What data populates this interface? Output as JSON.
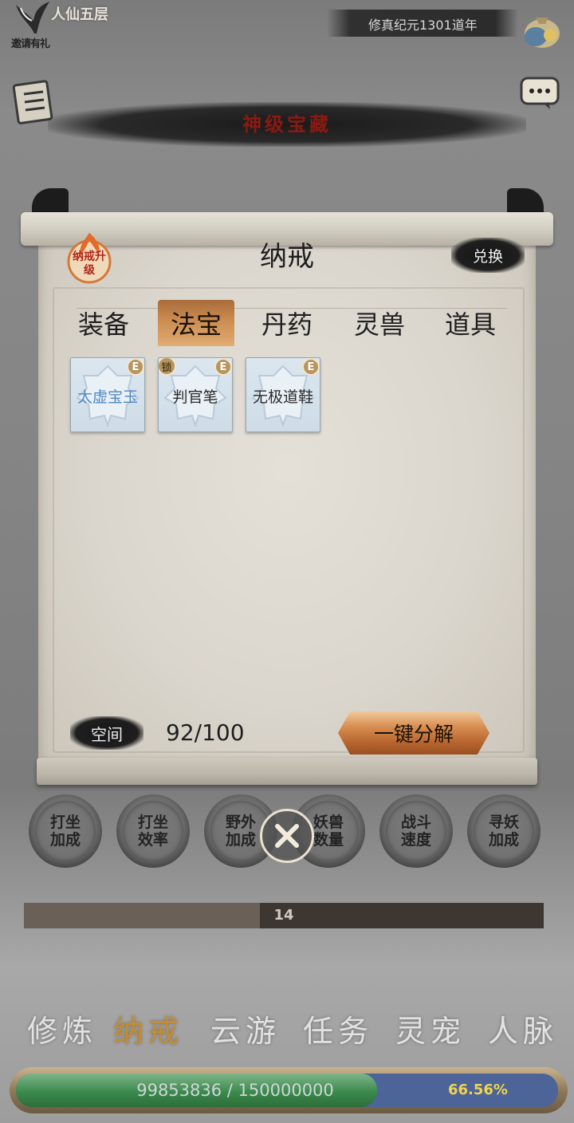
{
  "header": {
    "invite_text": "邀请有礼",
    "realm": "人仙五层",
    "era": "修真纪元1301道年",
    "title": "神级宝藏"
  },
  "panel": {
    "title": "纳戒",
    "upgrade_badge": "纳戒升级",
    "exchange_label": "兑换",
    "tabs": [
      {
        "label": "装备",
        "active": false
      },
      {
        "label": "法宝",
        "active": true
      },
      {
        "label": "丹药",
        "active": false
      },
      {
        "label": "灵兽",
        "active": false
      },
      {
        "label": "道具",
        "active": false
      }
    ],
    "items": [
      {
        "name": "太虚宝玉",
        "badge": "E",
        "locked": false,
        "name_color": "#4d88c4"
      },
      {
        "name": "判官笔",
        "badge": "E",
        "locked": true,
        "lock_label": "锁",
        "name_color": "#2a2a2a"
      },
      {
        "name": "无极道鞋",
        "badge": "E",
        "locked": false,
        "name_color": "#2a2a2a"
      }
    ],
    "space_label": "空间",
    "space_value": "92/100",
    "decompose_label": "一键分解"
  },
  "bonuses": [
    {
      "line1": "打坐",
      "line2": "加成"
    },
    {
      "line1": "打坐",
      "line2": "效率"
    },
    {
      "line1": "野外",
      "line2": "加成"
    },
    {
      "line1": "妖兽",
      "line2": "数量"
    },
    {
      "line1": "战斗",
      "line2": "速度"
    },
    {
      "line1": "寻妖",
      "line2": "加成"
    }
  ],
  "level": {
    "value": "14",
    "fill_fraction": 0.454
  },
  "nav": [
    {
      "label": "修炼",
      "active": false
    },
    {
      "label": "纳戒",
      "active": true
    },
    {
      "label": "云游",
      "active": false
    },
    {
      "label": "任务",
      "active": false
    },
    {
      "label": "灵宠",
      "active": false
    },
    {
      "label": "人脉",
      "active": false
    }
  ],
  "exp": {
    "text": "99853836 / 150000000",
    "percent": "66.56%",
    "fill_fraction": 0.6656
  },
  "colors": {
    "accent_gold": "#c58d2f",
    "tab_active": "#c9894f",
    "exp_green": "#3b8a4d",
    "exp_blue": "#4c6498",
    "percent_yellow": "#f0d54d"
  }
}
